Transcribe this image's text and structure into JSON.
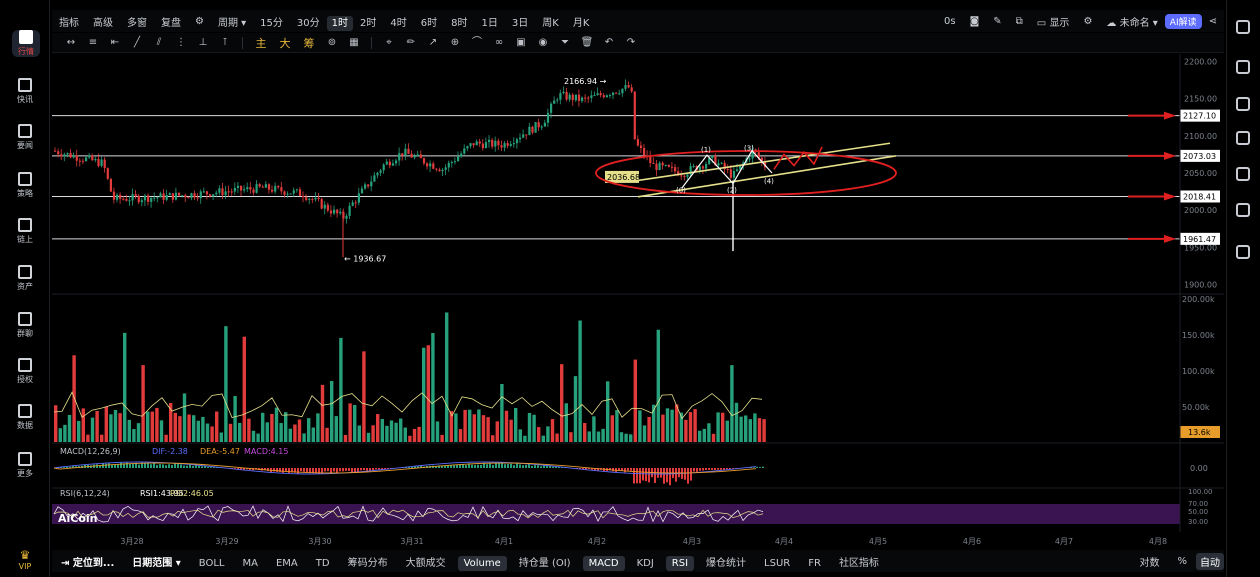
{
  "sidebar": {
    "items": [
      {
        "label": "行情",
        "icon": "chart-bars-icon",
        "active": true
      },
      {
        "label": "快讯",
        "icon": "flash-news-icon"
      },
      {
        "label": "要闻",
        "icon": "news-icon"
      },
      {
        "label": "策略",
        "icon": "strategy-icon"
      },
      {
        "label": "链上",
        "icon": "chain-icon"
      },
      {
        "label": "资产",
        "icon": "wallet-icon"
      },
      {
        "label": "群聊",
        "icon": "chat-icon"
      },
      {
        "label": "授权",
        "icon": "key-icon"
      },
      {
        "label": "数据",
        "icon": "data-icon"
      },
      {
        "label": "更多",
        "icon": "more-icon"
      }
    ],
    "vip_label": "VIP"
  },
  "topbar": {
    "items": [
      "指标",
      "高级",
      "多窗",
      "复盘"
    ],
    "period_label": "周期",
    "intervals": [
      "15分",
      "30分",
      "1时",
      "2时",
      "4时",
      "6时",
      "8时",
      "1日",
      "3日",
      "周K",
      "月K"
    ],
    "active_interval": "1时",
    "seconds_label": "0s",
    "display_label": "显示",
    "unnamed_label": "未命名",
    "ai_label": "AI解读"
  },
  "drawbar": {
    "tools": [
      "trend-line-tool",
      "horizontal-line-tool",
      "ray-tool",
      "parallel-channel-tool",
      "fib-tool",
      "measure-tool"
    ],
    "chinese_tools": [
      "主",
      "大",
      "筹"
    ]
  },
  "chart_data": [
    {
      "type": "candlestick",
      "title": "",
      "ylim": [
        1890,
        2210
      ],
      "y_ticks": [
        "2200.00",
        "2150.00",
        "2100.00",
        "2050.00",
        "2000.00",
        "1950.00",
        "1900.00"
      ],
      "x_ticks": [
        "3月28",
        "3月29",
        "3月30",
        "3月31",
        "4月1",
        "4月2",
        "4月3",
        "4月4",
        "4月5",
        "4月6",
        "4月7",
        "4月8"
      ],
      "price_tags": [
        {
          "label": "2127.10",
          "value": 2127.1
        },
        {
          "label": "2073.03",
          "value": 2073.03
        },
        {
          "label": "2018.41",
          "value": 2018.41
        },
        {
          "label": "1961.47",
          "value": 1961.47
        }
      ],
      "annotations": {
        "high": "2166.94",
        "low": "1936.67",
        "marked": "2036.68",
        "wave_labels": [
          "(0)",
          "(1)",
          "(2)",
          "(3)",
          "(4)"
        ]
      }
    },
    {
      "type": "bar",
      "title": "Volume",
      "y_ticks": [
        "200.00k",
        "150.00k",
        "100.00k",
        "50.00k"
      ],
      "current_value": "13.6k"
    },
    {
      "type": "line",
      "title": "MACD(12,26,9)",
      "dif_label": "DIF:-2.38",
      "dea_label": "DEA:-5.47",
      "macd_label": "MACD:4.15",
      "y_ticks": [
        "0.00"
      ]
    },
    {
      "type": "line",
      "title": "RSI(6,12,24)",
      "rsi1_label": "RSI1:43.95",
      "rsi2_label": "RSI2:46.05",
      "y_ticks": [
        "100.00",
        "70.00",
        "50.00",
        "30.00"
      ]
    }
  ],
  "watermark": "AiCoin",
  "bottombar": {
    "locate_label": "定位到...",
    "range_label": "日期范围",
    "indicators": [
      "BOLL",
      "MA",
      "EMA",
      "TD",
      "筹码分布",
      "大额成交",
      "Volume",
      "持仓量 (OI)",
      "MACD",
      "KDJ",
      "RSI",
      "爆仓统计",
      "LSUR",
      "FR",
      "社区指标"
    ],
    "active_indicators": [
      "Volume",
      "MACD",
      "RSI"
    ],
    "log_label": "对数",
    "pct_label": "%",
    "auto_label": "自动"
  },
  "colors": {
    "up": "#26a17b",
    "down": "#e23b3b",
    "ma": "#e6e08a",
    "ellipse": "#e02020",
    "channel": "#e6e08a"
  }
}
